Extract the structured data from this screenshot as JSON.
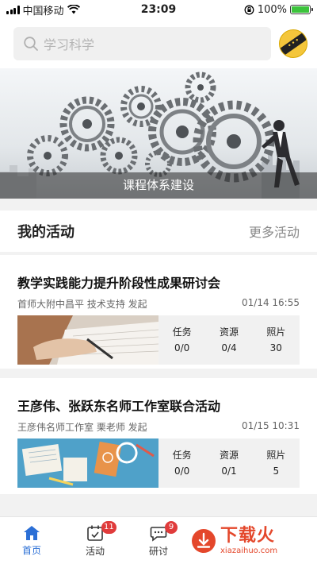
{
  "status_bar": {
    "carrier": "中国移动",
    "time": "23:09",
    "battery": "100%"
  },
  "header": {
    "search_placeholder": "学习科学"
  },
  "banner": {
    "caption": "课程体系建设"
  },
  "section": {
    "title": "我的活动",
    "more_label": "更多活动"
  },
  "activities": [
    {
      "title": "教学实践能力提升阶段性成果研讨会",
      "organizer": "首师大附中昌平 技术支持 发起",
      "datetime": "01/14 16:55",
      "stats": [
        {
          "label": "任务",
          "value": "0/0"
        },
        {
          "label": "资源",
          "value": "0/4"
        },
        {
          "label": "照片",
          "value": "30"
        }
      ]
    },
    {
      "title": "王彦伟、张跃东名师工作室联合活动",
      "organizer": "王彦伟名师工作室 栗老师 发起",
      "datetime": "01/15 10:31",
      "stats": [
        {
          "label": "任务",
          "value": "0/0"
        },
        {
          "label": "资源",
          "value": "0/1"
        },
        {
          "label": "照片",
          "value": "5"
        }
      ]
    }
  ],
  "bottom_nav": {
    "items": [
      {
        "label": "首页",
        "icon": "home-icon",
        "active": true
      },
      {
        "label": "活动",
        "icon": "calendar-icon",
        "badge": "11"
      },
      {
        "label": "研讨",
        "icon": "chat-icon",
        "badge": "9"
      }
    ]
  },
  "watermark": {
    "cn": "下载火",
    "en": "xiazaihuo.com"
  },
  "colors": {
    "accent": "#2b6fd6",
    "badge": "#e03b3b",
    "watermark": "#e4472b"
  }
}
